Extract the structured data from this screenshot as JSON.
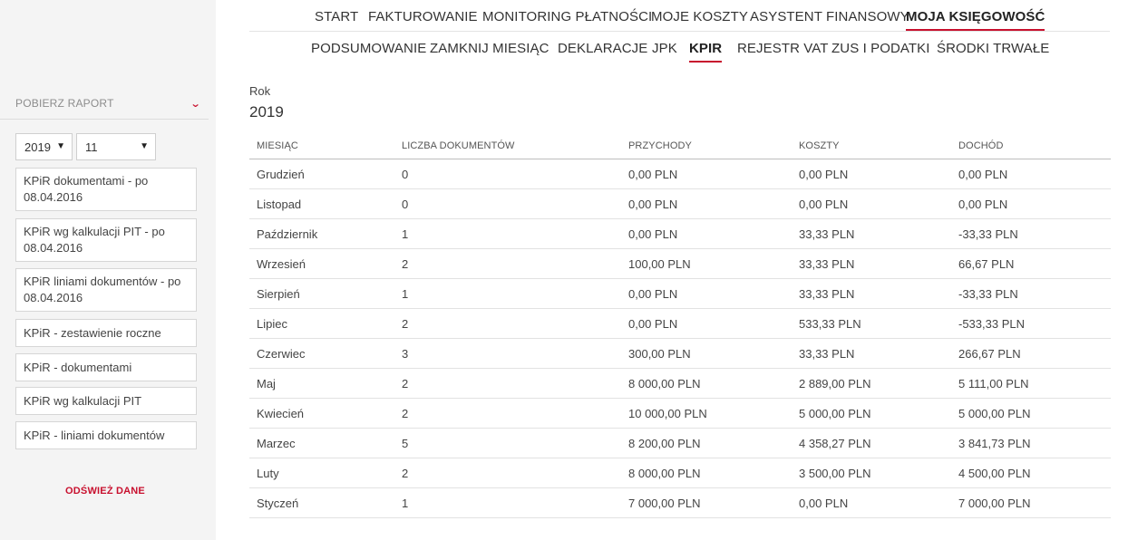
{
  "nav_main": [
    "START",
    "FAKTUROWANIE",
    "MONITORING PŁATNOŚCI",
    "MOJE KOSZTY",
    "ASYSTENT FINANSOWY",
    "MOJA KSIĘGOWOŚĆ"
  ],
  "nav_sub": [
    "PODSUMOWANIE",
    "ZAMKNIJ MIESIĄC",
    "DEKLARACJE",
    "JPK",
    "KPIR",
    "REJESTR VAT",
    "ZUS I PODATKI",
    "ŚRODKI TRWAŁE"
  ],
  "sidebar": {
    "report_header": "POBIERZ RAPORT",
    "year_select": "2019",
    "month_select": "11",
    "reports": [
      "KPiR dokumentami - po 08.04.2016",
      "KPiR wg kalkulacji PIT - po 08.04.2016",
      "KPiR liniami dokumentów - po 08.04.2016",
      "KPiR - zestawienie roczne",
      "KPiR - dokumentami",
      "KPiR wg kalkulacji PIT",
      "KPiR - liniami dokumentów"
    ],
    "refresh": "ODŚWIEŻ DANE"
  },
  "year": {
    "label": "Rok",
    "value": "2019"
  },
  "table": {
    "headers": [
      "MIESIĄC",
      "LICZBA DOKUMENTÓW",
      "PRZYCHODY",
      "KOSZTY",
      "DOCHÓD"
    ],
    "rows": [
      [
        "Grudzień",
        "0",
        "0,00 PLN",
        "0,00 PLN",
        "0,00 PLN"
      ],
      [
        "Listopad",
        "0",
        "0,00 PLN",
        "0,00 PLN",
        "0,00 PLN"
      ],
      [
        "Październik",
        "1",
        "0,00 PLN",
        "33,33 PLN",
        "-33,33 PLN"
      ],
      [
        "Wrzesień",
        "2",
        "100,00 PLN",
        "33,33 PLN",
        "66,67 PLN"
      ],
      [
        "Sierpień",
        "1",
        "0,00 PLN",
        "33,33 PLN",
        "-33,33 PLN"
      ],
      [
        "Lipiec",
        "2",
        "0,00 PLN",
        "533,33 PLN",
        "-533,33 PLN"
      ],
      [
        "Czerwiec",
        "3",
        "300,00 PLN",
        "33,33 PLN",
        "266,67 PLN"
      ],
      [
        "Maj",
        "2",
        "8 000,00 PLN",
        "2 889,00 PLN",
        "5 111,00 PLN"
      ],
      [
        "Kwiecień",
        "2",
        "10 000,00 PLN",
        "5 000,00 PLN",
        "5 000,00 PLN"
      ],
      [
        "Marzec",
        "5",
        "8 200,00 PLN",
        "4 358,27 PLN",
        "3 841,73 PLN"
      ],
      [
        "Luty",
        "2",
        "8 000,00 PLN",
        "3 500,00 PLN",
        "4 500,00 PLN"
      ],
      [
        "Styczeń",
        "1",
        "7 000,00 PLN",
        "0,00 PLN",
        "7 000,00 PLN"
      ]
    ]
  },
  "colors": {
    "accent": "#c8102e",
    "sidebar_bg": "#f4f4f4"
  }
}
